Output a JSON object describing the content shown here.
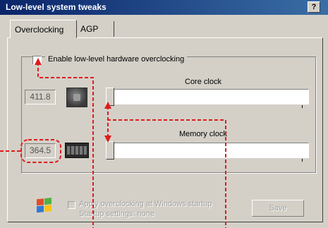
{
  "window": {
    "title": "Low-level system tweaks",
    "help_button": "?"
  },
  "tabs": [
    {
      "label": "Overclocking",
      "active": true
    },
    {
      "label": "AGP",
      "active": false
    }
  ],
  "overclocking": {
    "enable_label": "Enable low-level hardware overclocking",
    "enable_checked": false,
    "core_clock": {
      "caption": "Core clock",
      "value": "411.8",
      "icon": "gpu-chip-icon"
    },
    "memory_clock": {
      "caption": "Memory clock",
      "value": "364.5",
      "icon": "memory-chip-icon"
    },
    "apply_label": "Apply overclocking at Windows startup",
    "status_label": "Startup settings: none",
    "save_label": "Save",
    "windows_icon": "windows-logo-icon"
  },
  "colors": {
    "titlebar_start": "#0a246a",
    "titlebar_end": "#3a6ea5",
    "dialog_face": "#d4d0c8",
    "annotation_red": "#e01b1b"
  }
}
